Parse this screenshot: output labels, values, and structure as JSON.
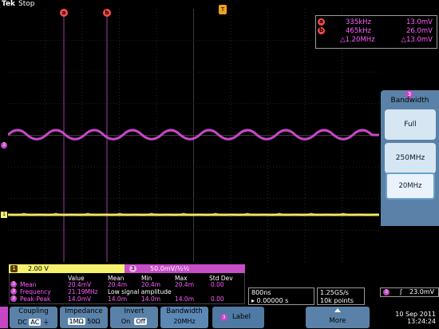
{
  "status": {
    "brand": "Tek",
    "acquisition": "Stop"
  },
  "graticule_markers": {
    "cursor_a": "a",
    "cursor_b": "b",
    "trigger": "T",
    "ch3_ground": "3",
    "ch1_ground": "1"
  },
  "cursor_readout": {
    "a": {
      "freq": "335kHz",
      "value": "13.0mV"
    },
    "b": {
      "freq": "465kHz",
      "value": "26.0mV"
    },
    "delta": {
      "freq": "△1.20MHz",
      "value": "△13.0mV"
    }
  },
  "side_menu": {
    "number": "3",
    "title": "Bandwidth",
    "options": [
      "Full",
      "250MHz",
      "20MHz"
    ],
    "selected": "20MHz"
  },
  "channels": {
    "ch1": {
      "number": "1",
      "scale": "2.00 V",
      "color": "#f5f06e"
    },
    "ch3": {
      "number": "3",
      "scale": "50.0mV/½½",
      "color": "#c64ec6"
    }
  },
  "measurements": {
    "headers": [
      "Value",
      "Mean",
      "Min",
      "Max",
      "Std Dev"
    ],
    "rows": [
      {
        "num": "3",
        "label": "Mean",
        "value": "20.4mV",
        "mean": "20.4m",
        "min": "20.4m",
        "max": "20.4m",
        "std": "0.00"
      },
      {
        "num": "3",
        "label": "Frequency",
        "value": "21.19MHz",
        "note": "Low signal amplitude"
      },
      {
        "num": "3",
        "label": "Peak-Peak",
        "value": "14.0mV",
        "mean": "14.0m",
        "min": "14.0m",
        "max": "14.0m",
        "std": "0.00"
      }
    ]
  },
  "horizontal": {
    "scale": "800ns",
    "position": "▸ 0.00000 s",
    "sample_rate": "1.25GS/s",
    "record": "10k points"
  },
  "trigger": {
    "number": "3",
    "slope": "ʃ",
    "level": "23.0mV"
  },
  "bottom_menu": {
    "coupling": {
      "title": "Coupling",
      "options": [
        "DC",
        "AC",
        "⏚"
      ],
      "selected": "AC"
    },
    "impedance": {
      "title": "Impedance",
      "options": [
        "1MΩ",
        "50Ω"
      ],
      "selected": "1MΩ"
    },
    "invert": {
      "title": "Invert",
      "options": [
        "On",
        "Off"
      ],
      "selected": "Off"
    },
    "bandwidth": {
      "title": "Bandwidth",
      "value": "20MHz"
    },
    "label": {
      "num": "3",
      "title": "Label"
    },
    "more": {
      "title": "More"
    }
  },
  "datetime": {
    "date": "10 Sep 2011",
    "time": "13:24:24"
  }
}
